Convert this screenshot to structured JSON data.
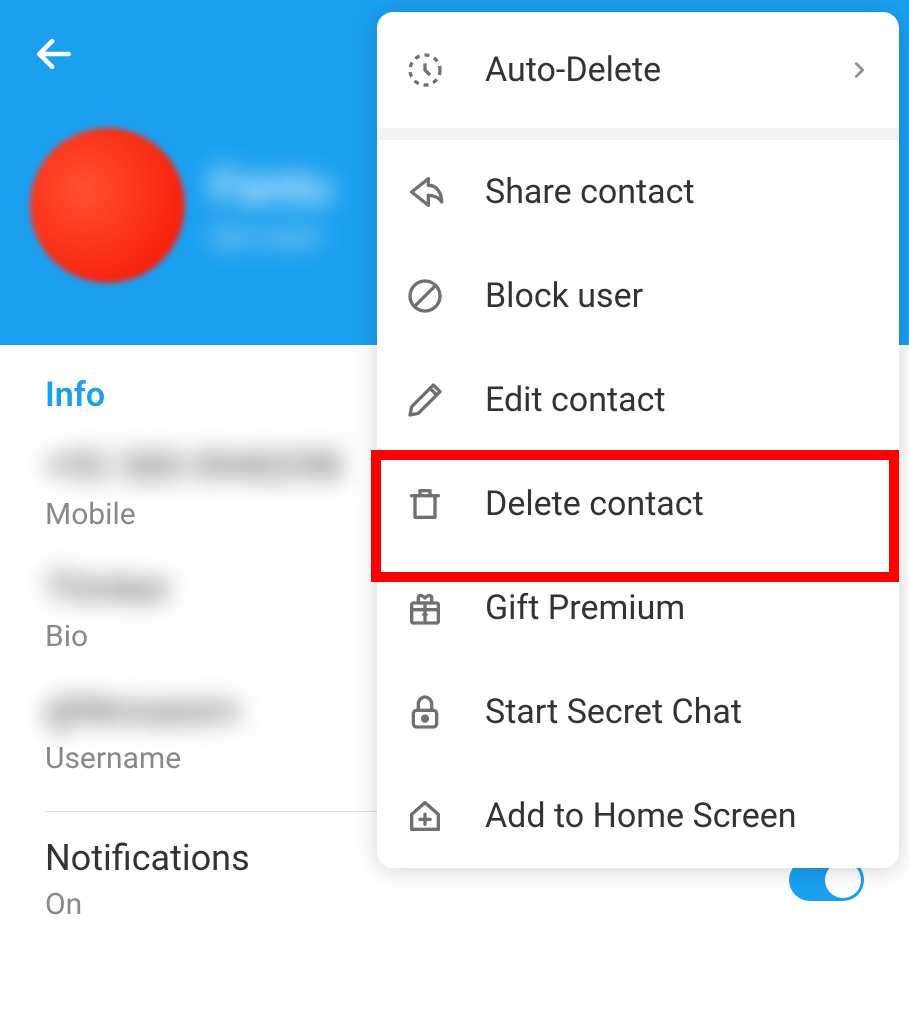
{
  "header": {
    "profile_name": "Fantu",
    "profile_status": "last seen"
  },
  "info": {
    "section_title": "Info",
    "phone_value": "+92 300 0940298",
    "phone_label": "Mobile",
    "bio_value": "Thinker",
    "bio_label": "Bio",
    "username_value": "@Ninsaism",
    "username_label": "Username"
  },
  "notifications": {
    "title": "Notifications",
    "status": "On"
  },
  "menu": {
    "auto_delete": "Auto-Delete",
    "share_contact": "Share contact",
    "block_user": "Block user",
    "edit_contact": "Edit contact",
    "delete_contact": "Delete contact",
    "gift_premium": "Gift Premium",
    "start_secret_chat": "Start Secret Chat",
    "add_to_home_screen": "Add to Home Screen"
  }
}
